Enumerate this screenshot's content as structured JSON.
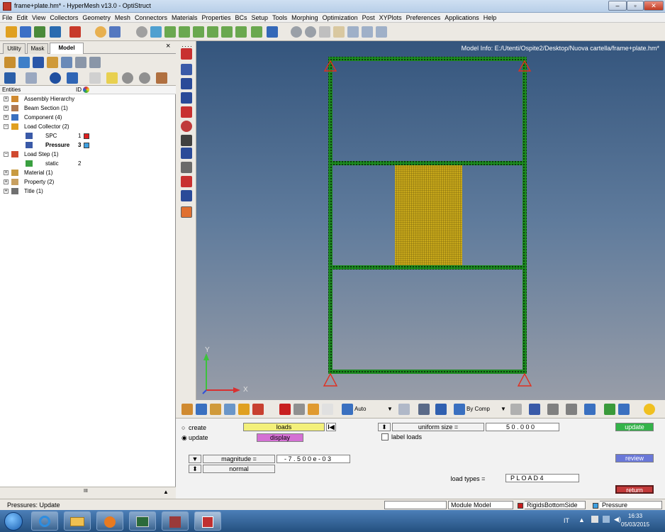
{
  "window": {
    "title": "frame+plate.hm* - HyperMesh v13.0 - OptiStruct",
    "minimize_label": "–",
    "maximize_label": "▫",
    "close_label": "✕"
  },
  "menu": [
    "File",
    "Edit",
    "View",
    "Collectors",
    "Geometry",
    "Mesh",
    "Connectors",
    "Materials",
    "Properties",
    "BCs",
    "Setup",
    "Tools",
    "Morphing",
    "Optimization",
    "Post",
    "XYPlots",
    "Preferences",
    "Applications",
    "Help"
  ],
  "browser": {
    "tabs": [
      "Utility",
      "Mask",
      "Model"
    ],
    "active_tab": "Model",
    "close_glyph": "×",
    "col_entities": "Entities",
    "col_id": "ID",
    "tree": [
      {
        "label": "Assembly Hierarchy",
        "level": 0,
        "expander": "+",
        "icon": "assembly-icon"
      },
      {
        "label": "Beam Section (1)",
        "level": 0,
        "expander": "+",
        "icon": "beam-section-icon"
      },
      {
        "label": "Component (4)",
        "level": 0,
        "expander": "+",
        "icon": "component-icon"
      },
      {
        "label": "Load Collector (2)",
        "level": 0,
        "expander": "−",
        "icon": "load-collector-icon"
      },
      {
        "label": "SPC",
        "level": 1,
        "id": "1",
        "color": "#e02020",
        "icon": "loadcol-item-icon"
      },
      {
        "label": "Pressure",
        "level": 1,
        "id": "3",
        "color": "#3ea0e0",
        "bold": true,
        "icon": "loadcol-item-icon"
      },
      {
        "label": "Load Step (1)",
        "level": 0,
        "expander": "−",
        "icon": "load-step-icon"
      },
      {
        "label": "static",
        "level": 1,
        "id": "2",
        "icon": "load-step-item-icon"
      },
      {
        "label": "Material (1)",
        "level": 0,
        "expander": "+",
        "icon": "material-icon"
      },
      {
        "label": "Property (2)",
        "level": 0,
        "expander": "+",
        "icon": "property-icon"
      },
      {
        "label": "Title (1)",
        "level": 0,
        "expander": "+",
        "icon": "title-icon"
      }
    ],
    "scroll_grip": "III"
  },
  "viewport": {
    "model_info": "Model Info: E:/Utenti/Ospite2/Desktop/Nuova cartella/frame+plate.hm*",
    "axis_y": "Y",
    "axis_x": "X"
  },
  "bottom_toolbar": {
    "auto_label": "Auto",
    "bycomp_label": "By Comp"
  },
  "panel": {
    "create_label": "create",
    "update_label": "update",
    "mode": "update",
    "loads_label": "loads",
    "display_label": "display",
    "uniform_size_label": "uniform size =",
    "uniform_size_value": "5 0 . 0 0 0",
    "label_loads": "label loads",
    "magnitude_label": "magnitude =",
    "magnitude_value": "- 7 . 5 0 0 e - 0 3",
    "normal_label": "normal",
    "load_types_label": "load types =",
    "load_types_value": "P L O A D 4",
    "update_button": "update",
    "review_button": "review",
    "return_button": "return",
    "colors": {
      "loads": "#f3f07a",
      "display": "#d470d4",
      "update": "#34b34a",
      "review": "#6a78d8",
      "return": "#c23a3a"
    }
  },
  "status": {
    "message": "Pressures: Update",
    "module": "Module Model",
    "component": "RigidsBottomSide",
    "loadcol": "Pressure"
  },
  "taskbar": {
    "lang": "IT",
    "time": "16:33",
    "date": "05/03/2015"
  }
}
